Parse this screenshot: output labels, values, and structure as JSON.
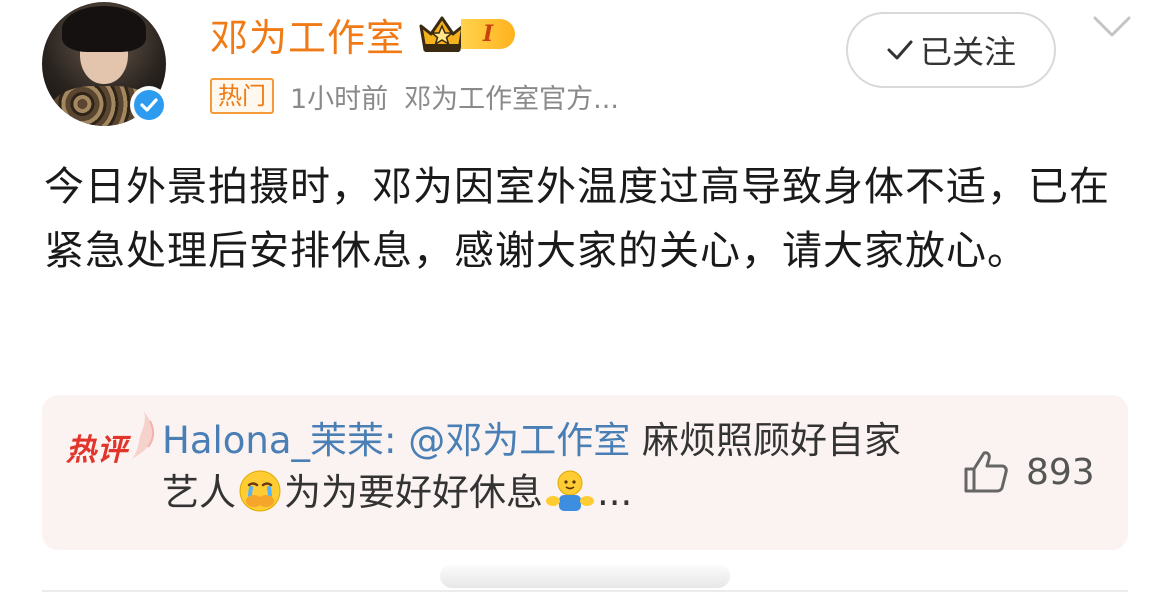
{
  "author": {
    "name": "邓为工作室",
    "level_badge": "I",
    "verified_icon": "verified-check-icon"
  },
  "meta": {
    "tag": "热门",
    "time": "1小时前",
    "source": "邓为工作室官方..."
  },
  "follow_button": {
    "label": "已关注",
    "icon": "checkmark-icon"
  },
  "post": {
    "text": "今日外景拍摄时，邓为因室外温度过高导致身体不适，已在紧急处理后安排休息，感谢大家的关心，请大家放心。"
  },
  "hot_comment": {
    "label": "热评",
    "user": "Halona_茉茉:",
    "mention": "@邓为工作室",
    "text_part1": " 麻烦照顾好自家艺人",
    "text_part2": "为为要好好休息",
    "ellipsis": "...",
    "likes": "893",
    "emojis": [
      "crying-covering-mouth-emoji",
      "hugging-emoji"
    ]
  },
  "colors": {
    "accent_orange": "#f07b16",
    "mention_blue": "#4a7fb5",
    "hot_red": "#e2342a",
    "verified_blue": "#2d9cf0",
    "comment_bg": "#fbf3f1"
  }
}
